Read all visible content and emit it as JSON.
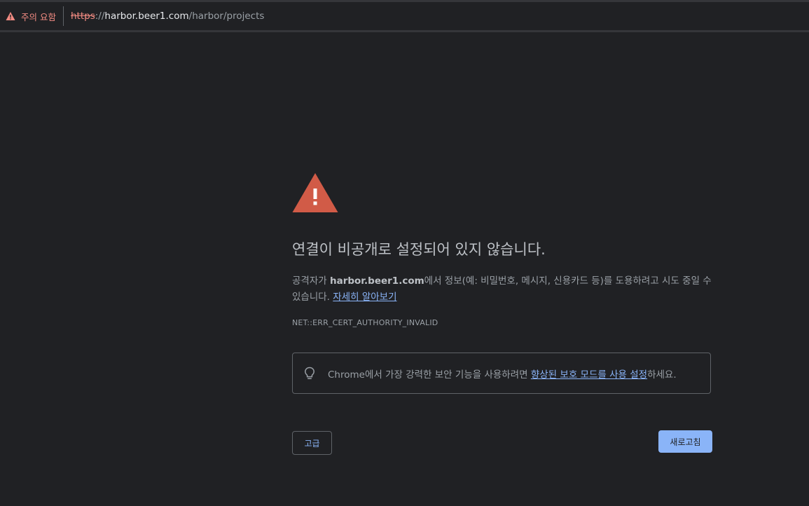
{
  "omnibox": {
    "security_label": "주의 요함",
    "url_scheme": "https",
    "url_sep": "://",
    "url_host": "harbor.beer1.com",
    "url_path": "/harbor/projects"
  },
  "interstitial": {
    "heading": "연결이 비공개로 설정되어 있지 않습니다.",
    "desc_prefix": "공격자가 ",
    "desc_host": "harbor.beer1.com",
    "desc_suffix": "에서 정보(예: 비밀번호, 메시지, 신용카드 등)를 도용하려고 시도 중일 수 있습니다. ",
    "learn_more": "자세히 알아보기",
    "error_code": "NET::ERR_CERT_AUTHORITY_INVALID",
    "tip_prefix": "Chrome에서 가장 강력한 보안 기능을 사용하려면 ",
    "tip_link": "향상된 보호 모드를 사용 설정",
    "tip_suffix": "하세요.",
    "advanced_button": "고급",
    "reload_button": "새로고침"
  },
  "colors": {
    "background": "#202124",
    "warning_red": "#d15b47",
    "link_blue": "#8ab4f8"
  },
  "icons": {
    "security_chip": "warning-triangle-icon",
    "main": "warning-triangle-icon",
    "tip": "lightbulb-icon"
  }
}
